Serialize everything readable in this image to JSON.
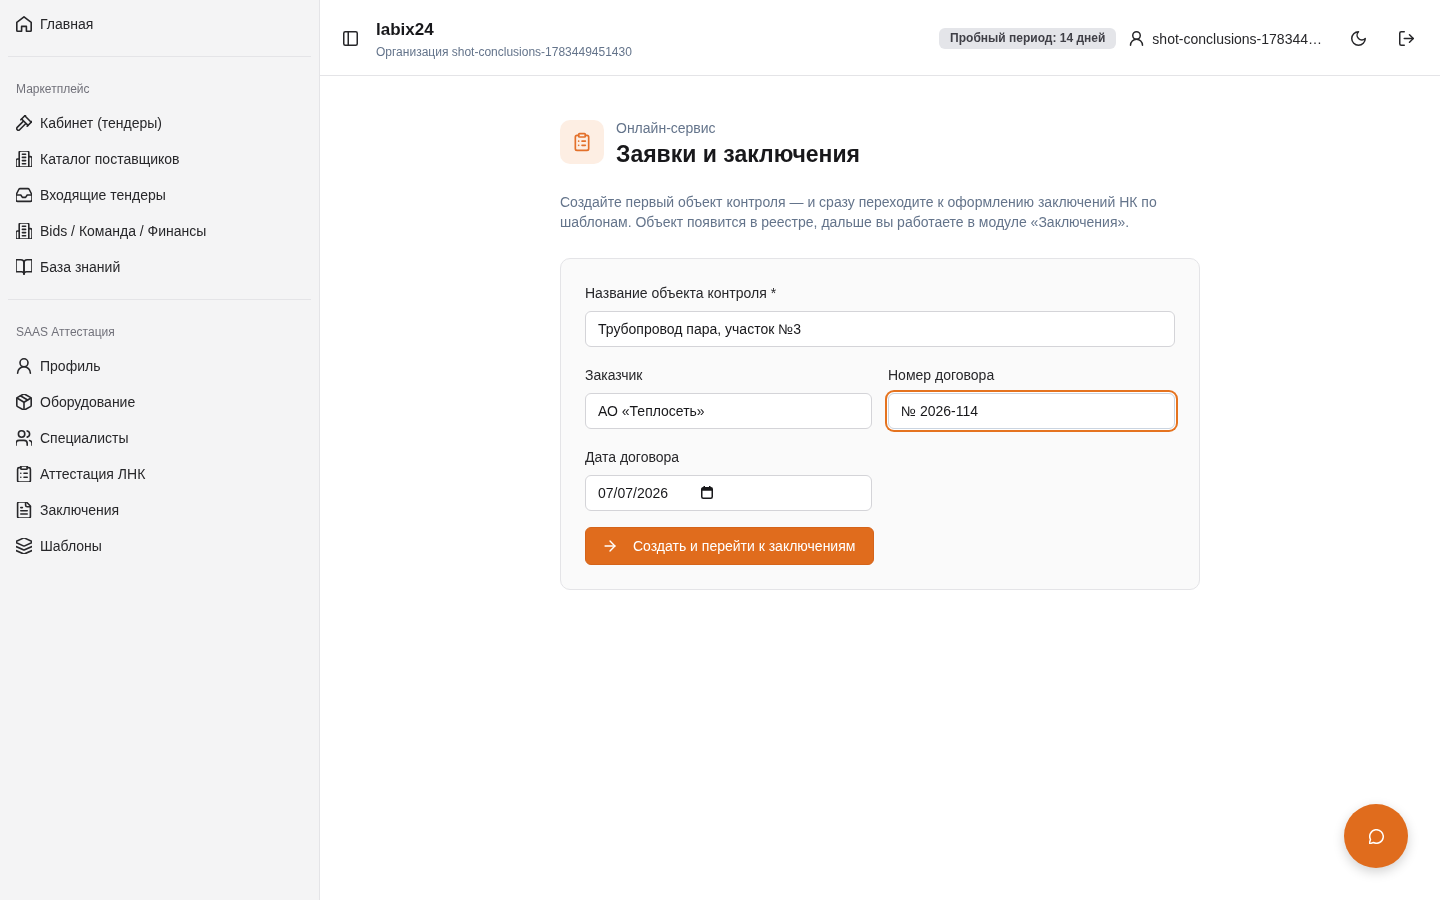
{
  "sidebar": {
    "groups": [
      {
        "items": [
          {
            "label": "Главная"
          }
        ]
      },
      {
        "title": "Маркетплейс",
        "items": [
          {
            "label": "Кабинет (тендеры)"
          },
          {
            "label": "Каталог поставщиков"
          },
          {
            "label": "Входящие тендеры"
          },
          {
            "label": "Bids / Команда / Финансы"
          },
          {
            "label": "База знаний"
          }
        ]
      },
      {
        "title": "SAAS Аттестация",
        "items": [
          {
            "label": "Профиль"
          },
          {
            "label": "Оборудование"
          },
          {
            "label": "Специалисты"
          },
          {
            "label": "Аттестация ЛНК"
          },
          {
            "label": "Заключения"
          },
          {
            "label": "Шаблоны"
          }
        ]
      }
    ]
  },
  "header": {
    "title": "labix24",
    "subtitle": "Организация shot-conclusions-1783449451430",
    "trial_badge": "Пробный период: 14 дней",
    "user_name": "shot-conclusions-178344…"
  },
  "page": {
    "eyebrow": "Онлайн-сервис",
    "title": "Заявки и заключения",
    "description": "Создайте первый объект контроля — и сразу переходите к оформлению заключений НК по шаблонам. Объект появится в реестре, дальше вы работаете в модуле «Заключения»."
  },
  "form": {
    "fields": [
      {
        "kind": "text",
        "label": "Название объекта контроля *",
        "value": "Трубопровод пара, участок №3",
        "focused": false
      },
      {
        "kind": "text",
        "label": "Заказчик",
        "value": "АО «Теплосеть»",
        "focused": false
      },
      {
        "kind": "text",
        "label": "Номер договора",
        "value": "№ 2026-114",
        "focused": true
      },
      {
        "kind": "date",
        "label": "Дата договора",
        "value": "07/07/2026",
        "focused": false
      }
    ],
    "submit": {
      "label": "Создать и перейти к заключениям"
    }
  }
}
